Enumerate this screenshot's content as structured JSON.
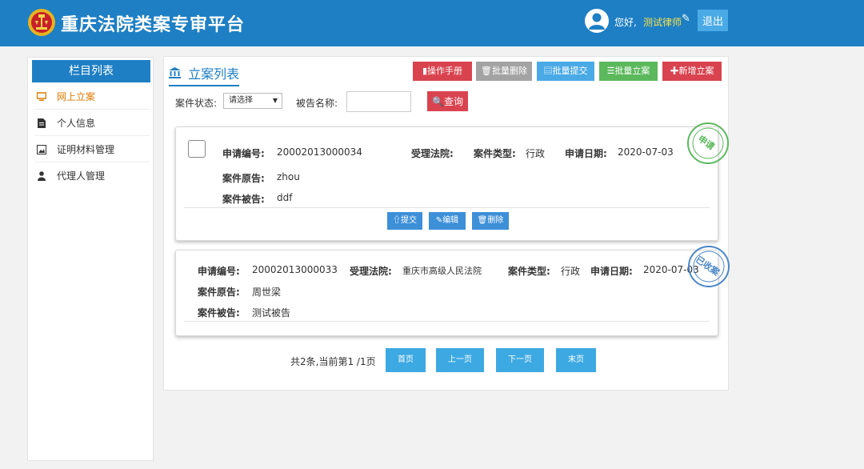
{
  "header": {
    "title": "重庆法院类案专审平台",
    "greeting": "您好,",
    "username": "测试律师",
    "logout_label": "退出"
  },
  "sidebar": {
    "title": "栏目列表",
    "items": [
      {
        "label": "网上立案",
        "icon": "monitor-icon",
        "active": true
      },
      {
        "label": "个人信息",
        "icon": "document-icon",
        "active": false
      },
      {
        "label": "证明材料管理",
        "icon": "image-icon",
        "active": false
      },
      {
        "label": "代理人管理",
        "icon": "user-icon",
        "active": false
      }
    ]
  },
  "main": {
    "title": "立案列表",
    "toolbar": {
      "manual": "操作手册",
      "batch_delete": "批量删除",
      "batch_submit": "批量提交",
      "batch_file": "批量立案",
      "add": "新增立案"
    },
    "filter": {
      "status_label": "案件状态:",
      "status_value": "请选择",
      "defendant_label": "被告名称:",
      "defendant_value": "",
      "query_label": "查询"
    },
    "labels": {
      "app_no": "申请编号:",
      "court": "受理法院:",
      "case_type": "案件类型:",
      "apply_date": "申请日期:",
      "plaintiff": "案件原告:",
      "defendant": "案件被告:"
    },
    "cases": [
      {
        "app_no": "20002013000034",
        "court": "",
        "case_type": "行政",
        "apply_date": "2020-07-03",
        "plaintiff": "zhou",
        "defendant": "ddf",
        "stamp": "申请",
        "actions": {
          "submit": "提交",
          "edit": "编辑",
          "delete": "删除"
        }
      },
      {
        "app_no": "20002013000033",
        "court": "重庆市高级人民法院",
        "case_type": "行政",
        "apply_date": "2020-07-03",
        "plaintiff": "周世梁",
        "defendant": "测试被告",
        "stamp": "已收案"
      }
    ],
    "pagination": {
      "info": "共2条,当前第1 /1页",
      "first": "首页",
      "prev": "上一页",
      "next": "下一页",
      "last": "末页"
    }
  },
  "colors": {
    "brand": "#1e7fc4",
    "danger": "#d9434f",
    "grey": "#a3a3a3",
    "info": "#4aaae6",
    "success": "#5cb85c",
    "active": "#e07b00"
  }
}
